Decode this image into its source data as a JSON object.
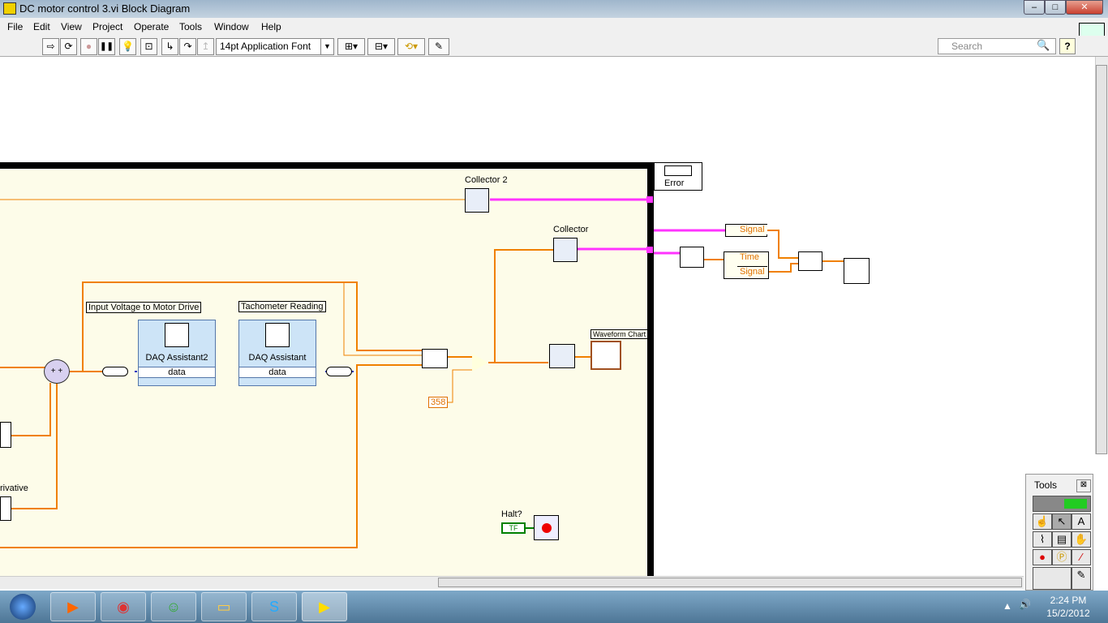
{
  "window": {
    "title": "DC motor control 3.vi Block Diagram",
    "minimize": "–",
    "maximize": "□",
    "close": "✕"
  },
  "menu": [
    "File",
    "Edit",
    "View",
    "Project",
    "Operate",
    "Tools",
    "Window",
    "Help"
  ],
  "toolbar": {
    "run": "⇨",
    "run_continuously": "⟳",
    "abort": "●",
    "pause": "❚❚",
    "highlight": "💡",
    "retain_wire": "⊡",
    "step_into": "↳",
    "step_over": "↷",
    "step_out": "↥",
    "font": "14pt Application Font",
    "align": "⊞▾",
    "distribute": "⊟▾",
    "reorder": "⟲▾",
    "cleanup": "✎"
  },
  "search": {
    "placeholder": "Search"
  },
  "help": "?",
  "diagram": {
    "collector2": "Collector 2",
    "collector": "Collector",
    "error": "Error",
    "daq1_label": "Input Voltage to Motor Drive",
    "daq1_name": "DAQ Assistant2",
    "daq1_out": "data",
    "daq2_label": "Tachometer Reading",
    "daq2_name": "DAQ Assistant",
    "daq2_out": "data",
    "constant": "358",
    "chart_label": "Waveform Chart",
    "halt": "Halt?",
    "halt_const": "TF",
    "derivative": "rivative",
    "signal1": "Signal",
    "time": "Time",
    "signal2": "Signal"
  },
  "tools_palette": {
    "title": "Tools",
    "close": "⊠"
  },
  "clock": {
    "time": "2:24 PM",
    "date": "15/2/2012"
  },
  "colors": {
    "loop_bg": "#fdfce9",
    "numeric_wire": "#f08000",
    "cluster_wire": "#ff33ff",
    "bool_wire": "#008000"
  }
}
